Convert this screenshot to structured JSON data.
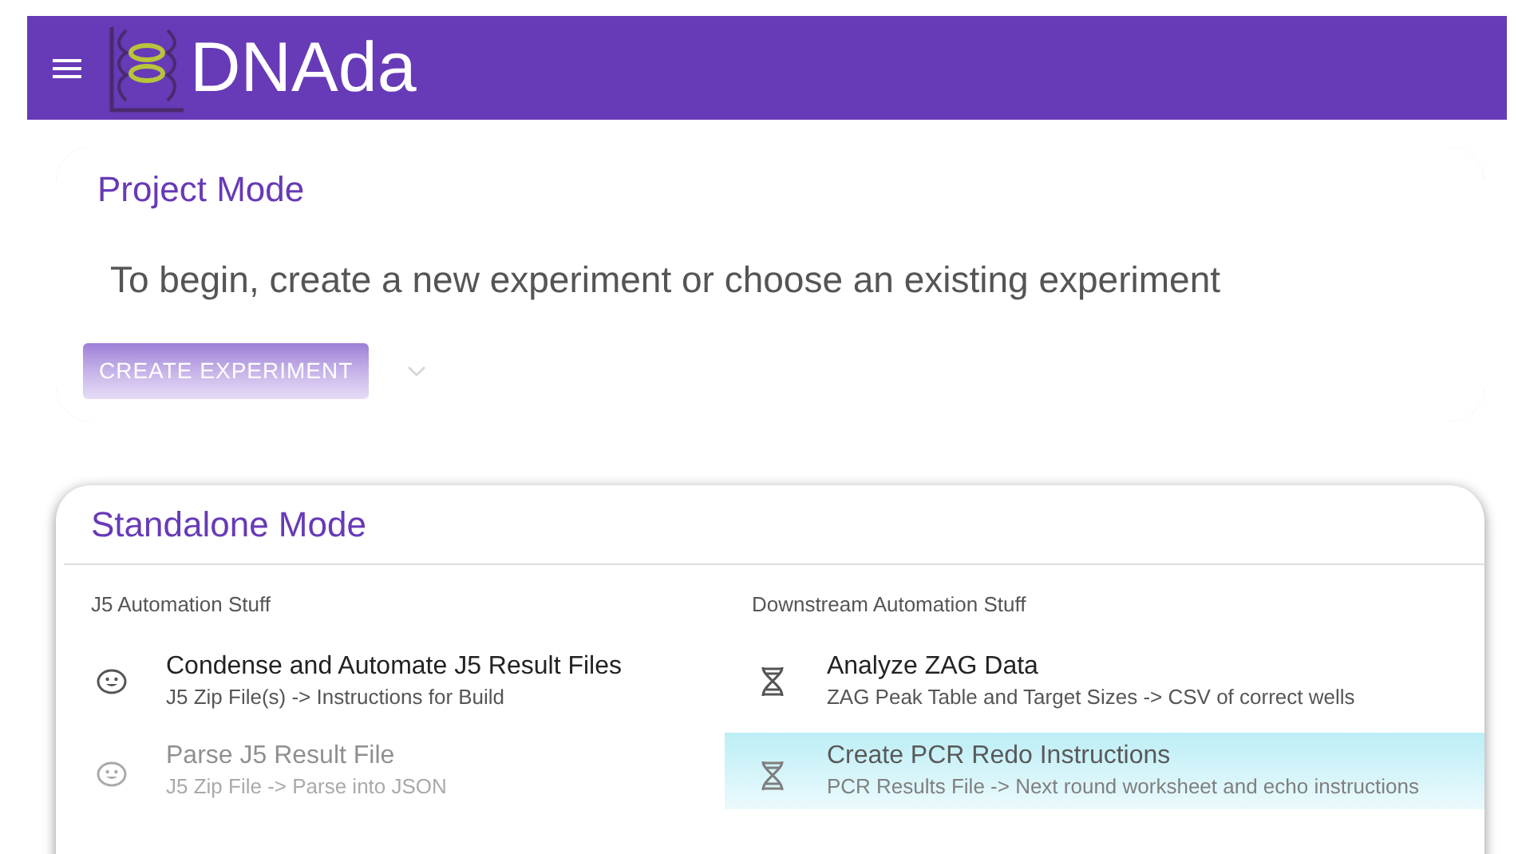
{
  "app_bar": {
    "title": "DNAda"
  },
  "project_card": {
    "title": "Project Mode",
    "message": "To begin, create a new experiment or choose an existing experiment",
    "button": "CREATE EXPERIMENT"
  },
  "standalone_card": {
    "title": "Standalone Mode",
    "columns": [
      {
        "heading": "J5 Automation Stuff",
        "items": [
          {
            "kind": "face",
            "title": "Condense and Automate J5 Result Files",
            "subtitle": "J5 Zip File(s) -> Instructions for Build",
            "selected": false
          },
          {
            "kind": "face",
            "title": "Parse J5 Result File",
            "subtitle": "J5 Zip File -> Parse into JSON",
            "selected": false
          }
        ]
      },
      {
        "heading": "Downstream Automation Stuff",
        "items": [
          {
            "kind": "dna",
            "title": "Analyze ZAG Data",
            "subtitle": "ZAG Peak Table and Target Sizes -> CSV of correct wells",
            "selected": false
          },
          {
            "kind": "dna",
            "title": "Create PCR Redo Instructions",
            "subtitle": "PCR Results File -> Next round worksheet and echo instructions",
            "selected": true
          }
        ]
      }
    ]
  }
}
